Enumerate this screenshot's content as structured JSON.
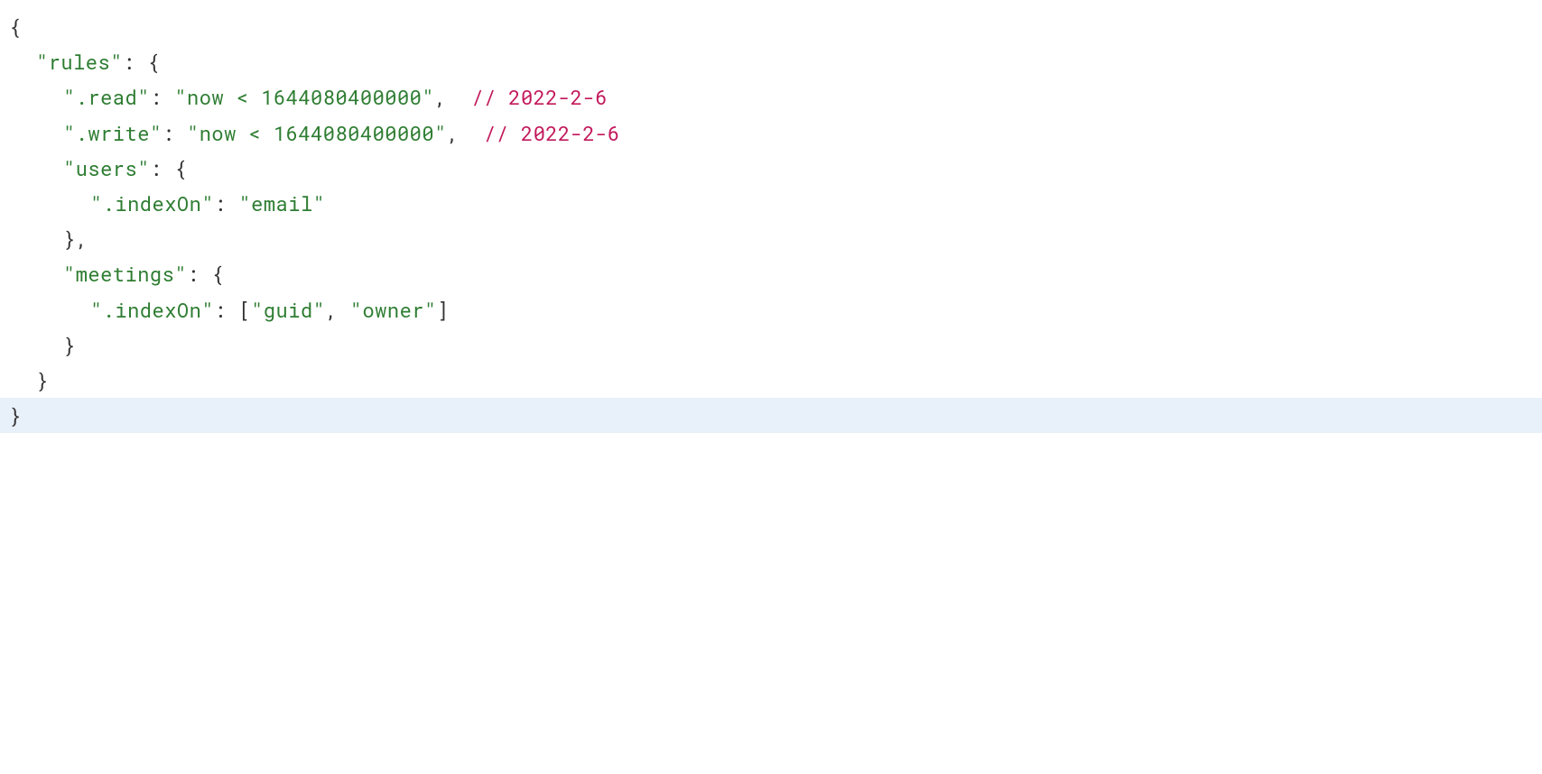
{
  "code": {
    "line1": "{",
    "line2_key": "\"rules\"",
    "line2_rest": ": {",
    "line3_key": "\".read\"",
    "line3_colon": ": ",
    "line3_value": "\"now < 1644080400000\"",
    "line3_comma": ",  ",
    "line3_comment": "// 2022-2-6",
    "line4_key": "\".write\"",
    "line4_colon": ": ",
    "line4_value": "\"now < 1644080400000\"",
    "line4_comma": ",  ",
    "line4_comment": "// 2022-2-6",
    "line5_key": "\"users\"",
    "line5_rest": ": {",
    "line6_key": "\".indexOn\"",
    "line6_colon": ": ",
    "line6_value": "\"email\"",
    "line7": "},",
    "line8_key": "\"meetings\"",
    "line8_rest": ": {",
    "line9_key": "\".indexOn\"",
    "line9_colon": ": [",
    "line9_val1": "\"guid\"",
    "line9_sep": ", ",
    "line9_val2": "\"owner\"",
    "line9_close": "]",
    "line10": "}",
    "line11": "}",
    "line12": "}"
  }
}
